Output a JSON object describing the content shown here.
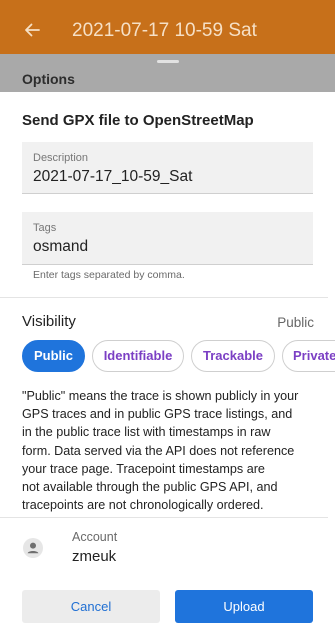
{
  "appbar": {
    "title": "2021-07-17 10-59 Sat",
    "back_icon": "arrow-back-icon"
  },
  "options": {
    "header_label": "Options",
    "section_title": "Send GPX file to OpenStreetMap"
  },
  "description_field": {
    "label": "Description",
    "value": "2021-07-17_10-59_Sat"
  },
  "tags_field": {
    "label": "Tags",
    "value": "osmand",
    "hint": "Enter tags separated by comma."
  },
  "visibility": {
    "label": "Visibility",
    "current": "Public",
    "chips": [
      "Public",
      "Identifiable",
      "Trackable",
      "Private"
    ],
    "selected_index": 0,
    "description_lines": [
      "\"Public\" means the trace is shown publicly in your",
      "GPS traces and in public GPS trace listings, and",
      "in the public trace list with timestamps in raw",
      "form. Data served via the API does not reference",
      "your trace page. Tracepoint timestamps are",
      "not available through the public GPS API, and",
      "tracepoints are not chronologically ordered."
    ]
  },
  "account": {
    "label": "Account",
    "value": "zmeuk",
    "icon": "account-circle-icon"
  },
  "buttons": {
    "cancel": "Cancel",
    "upload": "Upload"
  },
  "colors": {
    "appbar": "#c7701a",
    "accent": "#1f74dc",
    "chip_text": "#7b3fc4"
  }
}
